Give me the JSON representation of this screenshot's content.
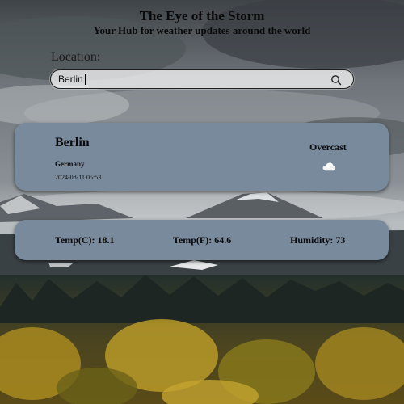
{
  "header": {
    "title": "The Eye of the Storm",
    "subtitle": "Your Hub for weather updates around the world"
  },
  "search": {
    "label": "Location:",
    "value": "Berlin",
    "button_icon": "search-icon"
  },
  "weather": {
    "city": "Berlin",
    "country": "Germany",
    "datetime": "2024-08-11 05:53",
    "condition": "Overcast",
    "condition_icon": "cloud-icon"
  },
  "stats": {
    "temp_c": "Temp(C): 18.1",
    "temp_f": "Temp(F): 64.6",
    "humidity": "Humidity: 73"
  },
  "colors": {
    "card": "#7a8a9d",
    "sky": "#5d636a"
  }
}
